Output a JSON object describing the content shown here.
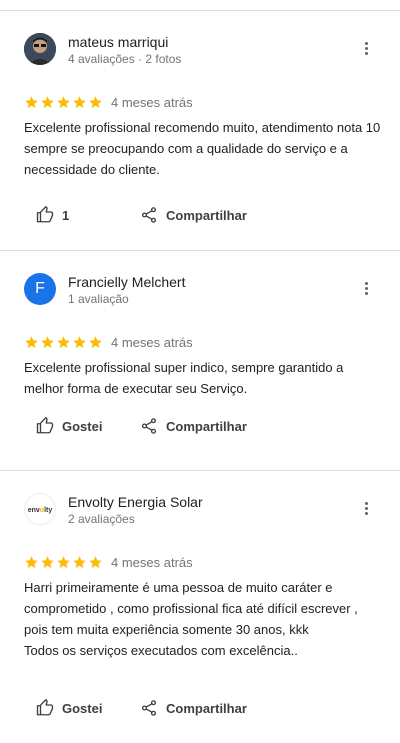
{
  "reviews": [
    {
      "name": "mateus marriqui",
      "meta": "4 avaliações · 2 fotos",
      "avatar_letter": "",
      "stars": 5,
      "time": "4 meses atrás",
      "text": "Excelente profissional recomendo muito, atendimento nota 10 sempre se preocupando com a qualidade do serviço e a necessidade do cliente.",
      "like_label": "1",
      "share_label": "Compartilhar"
    },
    {
      "name": "Francielly Melchert",
      "meta": "1 avaliação",
      "avatar_letter": "F",
      "stars": 5,
      "time": "4 meses atrás",
      "text": "Excelente profissional super indico, sempre garantido a melhor forma de executar seu Serviço.",
      "like_label": "Gostei",
      "share_label": "Compartilhar"
    },
    {
      "name": "Envolty Energia Solar",
      "meta": "2 avaliações",
      "avatar_logo_text": "envolty",
      "stars": 5,
      "time": "4 meses atrás",
      "text": "Harri primeiramente é uma pessoa de muito caráter e comprometido , como profissional fica até difícil escrever , pois tem muita experiência somente 30 anos, kkk\nTodos os serviços executados com excelência..",
      "like_label": "Gostei",
      "share_label": "Compartilhar"
    }
  ],
  "colors": {
    "star": "#fbbc04",
    "avatar_letter_bg": "#1a73e8"
  },
  "icons": {
    "like": "thumb-up-icon",
    "share": "share-icon",
    "more": "more-vert-icon"
  }
}
